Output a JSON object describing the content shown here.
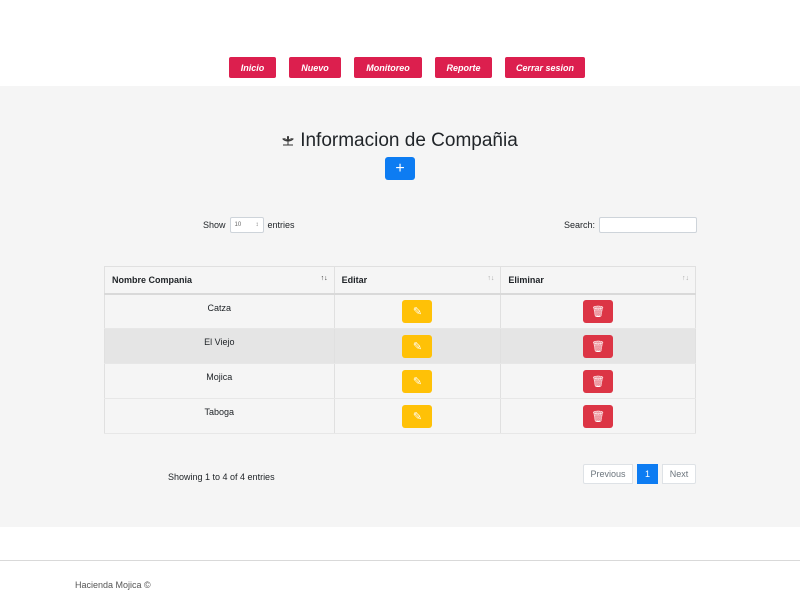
{
  "nav": {
    "items": [
      "Inicio",
      "Nuevo",
      "Monitoreo",
      "Reporte",
      "Cerrar sesion"
    ],
    "color": "#dc1f4e"
  },
  "page": {
    "title": "Informacion de Compañia",
    "title_icon": "leaf-icon",
    "add_icon": "+"
  },
  "controls": {
    "show_label": "Show",
    "entries_value": "10",
    "entries_label": "entries",
    "search_label": "Search:"
  },
  "table": {
    "columns": [
      "Nombre Compania",
      "Editar",
      "Eliminar"
    ],
    "rows": [
      {
        "name": "Catza"
      },
      {
        "name": "El Viejo"
      },
      {
        "name": "Mojica"
      },
      {
        "name": "Taboga"
      }
    ]
  },
  "pagination": {
    "info": "Showing 1 to 4 of 4 entries",
    "previous": "Previous",
    "current": "1",
    "next": "Next"
  },
  "footer": {
    "text": "Hacienda Mojica ©"
  },
  "colors": {
    "primary": "#0d7cf2",
    "warning": "#ffc107",
    "danger": "#dc3545"
  }
}
